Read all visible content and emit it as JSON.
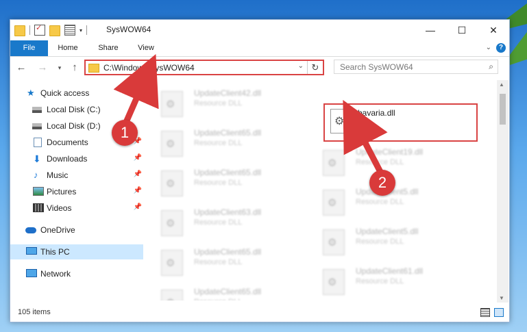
{
  "window": {
    "title": "SysWOW64",
    "controls": {
      "minimize": "—",
      "maximize": "☐",
      "close": "✕"
    }
  },
  "ribbon": {
    "tabs": [
      "File",
      "Home",
      "Share",
      "View"
    ],
    "help": "?"
  },
  "navigation": {
    "back": "←",
    "forward": "→",
    "recent": "▾",
    "up": "↑",
    "address": "C:\\Windows\\SysWOW64",
    "address_dropdown": "⌄",
    "refresh": "↻",
    "search_placeholder": "Search SysWOW64",
    "search_icon": "⌕"
  },
  "sidebar": {
    "items": [
      {
        "label": "Quick access",
        "icon": "star-icon"
      },
      {
        "label": "Local Disk (C:)",
        "icon": "disk-icon",
        "pinned": ""
      },
      {
        "label": "Local Disk (D:)",
        "icon": "disk-icon",
        "pinned": ""
      },
      {
        "label": "Documents",
        "icon": "documents-icon",
        "pinned": "📌"
      },
      {
        "label": "Downloads",
        "icon": "downloads-icon",
        "pinned": "📌"
      },
      {
        "label": "Music",
        "icon": "music-icon",
        "pinned": "📌"
      },
      {
        "label": "Pictures",
        "icon": "pictures-icon",
        "pinned": "📌"
      },
      {
        "label": "Videos",
        "icon": "videos-icon",
        "pinned": "📌"
      },
      {
        "label": "OneDrive",
        "icon": "onedrive-icon"
      },
      {
        "label": "This PC",
        "icon": "this-pc-icon",
        "selected": true
      },
      {
        "label": "Network",
        "icon": "network-icon"
      }
    ]
  },
  "files": {
    "left": [
      {
        "name": "UpdateClient42.dll",
        "type": "Resource DLL"
      },
      {
        "name": "UpdateClient65.dll",
        "type": "Resource DLL"
      },
      {
        "name": "UpdateClient65.dll",
        "type": "Resource DLL"
      },
      {
        "name": "UpdateClient63.dll",
        "type": "Resource DLL"
      },
      {
        "name": "UpdateClient65.dll",
        "type": "Resource DLL"
      },
      {
        "name": "UpdateClient65.dll",
        "type": "Resource DLL"
      }
    ],
    "right": [
      {
        "name": "UpdateClient19.dll",
        "type": "Resource DLL"
      },
      {
        "name": "UpdateClient5.dll",
        "type": "Resource DLL"
      },
      {
        "name": "UpdateClient5.dll",
        "type": "Resource DLL"
      },
      {
        "name": "UpdateClient61.dll",
        "type": "Resource DLL"
      }
    ],
    "highlighted": {
      "name": "bavaria.dll"
    }
  },
  "status": {
    "item_count": "105 items"
  },
  "annotations": {
    "step1": "1",
    "step2": "2"
  },
  "colors": {
    "accent": "#1979ca",
    "highlight": "#d94343"
  }
}
